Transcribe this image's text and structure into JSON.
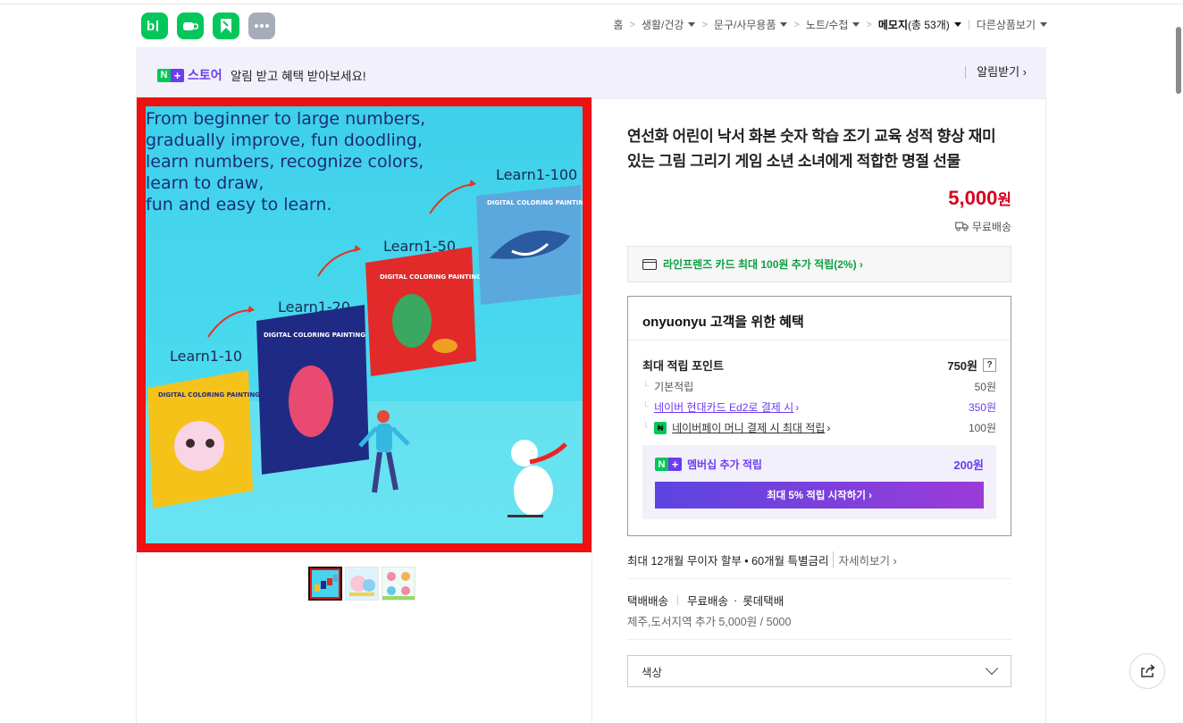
{
  "app_icons": [
    {
      "name": "blog-icon",
      "glyph": "b|"
    },
    {
      "name": "cafe-icon",
      "glyph": "☕"
    },
    {
      "name": "bookmark-icon",
      "glyph": "◤"
    },
    {
      "name": "more-icon",
      "glyph": "•••"
    }
  ],
  "breadcrumb": {
    "home": "홈",
    "items": [
      "생활/건강",
      "문구/사무용품",
      "노트/수첩"
    ],
    "current": "메모지",
    "current_count": "(총 53개)",
    "other": "다른상품보기"
  },
  "banner": {
    "store_label": "스토어",
    "text": "알림 받고 혜택 받아보세요!",
    "alarm_button": "알림받기 ›"
  },
  "main_image": {
    "headline_lines": [
      "From beginner to large numbers,",
      "gradually improve, fun doodling,",
      "learn numbers, recognize colors,",
      "learn to draw,",
      "fun and easy to learn."
    ],
    "labels": [
      "Learn1-10",
      "Learn1-20",
      "Learn1-50",
      "Learn1-100"
    ],
    "book_title": "DIGITAL COLORING PAINTING",
    "book_ranges": [
      "1-10",
      "1-20",
      "1-50",
      "1-100"
    ]
  },
  "product": {
    "title": "연선화 어린이 낙서 화본 숫자 학습 조기 교육 성적 향상 재미있는 그림 그리기 게임 소년 소녀에게 적합한 명절 선물",
    "price": "5,000",
    "price_unit": "원",
    "shipping": "무료배송"
  },
  "card_promo": "라인프렌즈 카드 최대 100원 추가 적립(2%) ›",
  "benefits": {
    "title": "onyuonyu 고객을 위한 혜택",
    "max_points_label": "최대 적립 포인트",
    "max_points_value": "750원",
    "help": "?",
    "rows": [
      {
        "label": "기본적립",
        "value": "50원"
      },
      {
        "label": "네이버 현대카드 Ed2로 결제 시",
        "value": "350원"
      },
      {
        "label": "네이버페이 머니 결제 시 최대 적립",
        "value": "100원"
      }
    ],
    "membership_label": "멤버십 추가 적립",
    "membership_value": "200원",
    "membership_button": "최대 5% 적립 시작하기 ›"
  },
  "installment": {
    "text": "최대 12개월 무이자 할부 • 60개월 특별금리",
    "more": "자세히보기 ›"
  },
  "delivery": {
    "type": "택배배송",
    "fee": "무료배송",
    "carrier": "롯데택배",
    "extra": "제주,도서지역 추가 5,000원 / 5000"
  },
  "option": {
    "label": "색상"
  },
  "colors": {
    "naver_green": "#03c75a",
    "plus_purple": "#6e3cf0",
    "price_red": "#d6001c"
  }
}
